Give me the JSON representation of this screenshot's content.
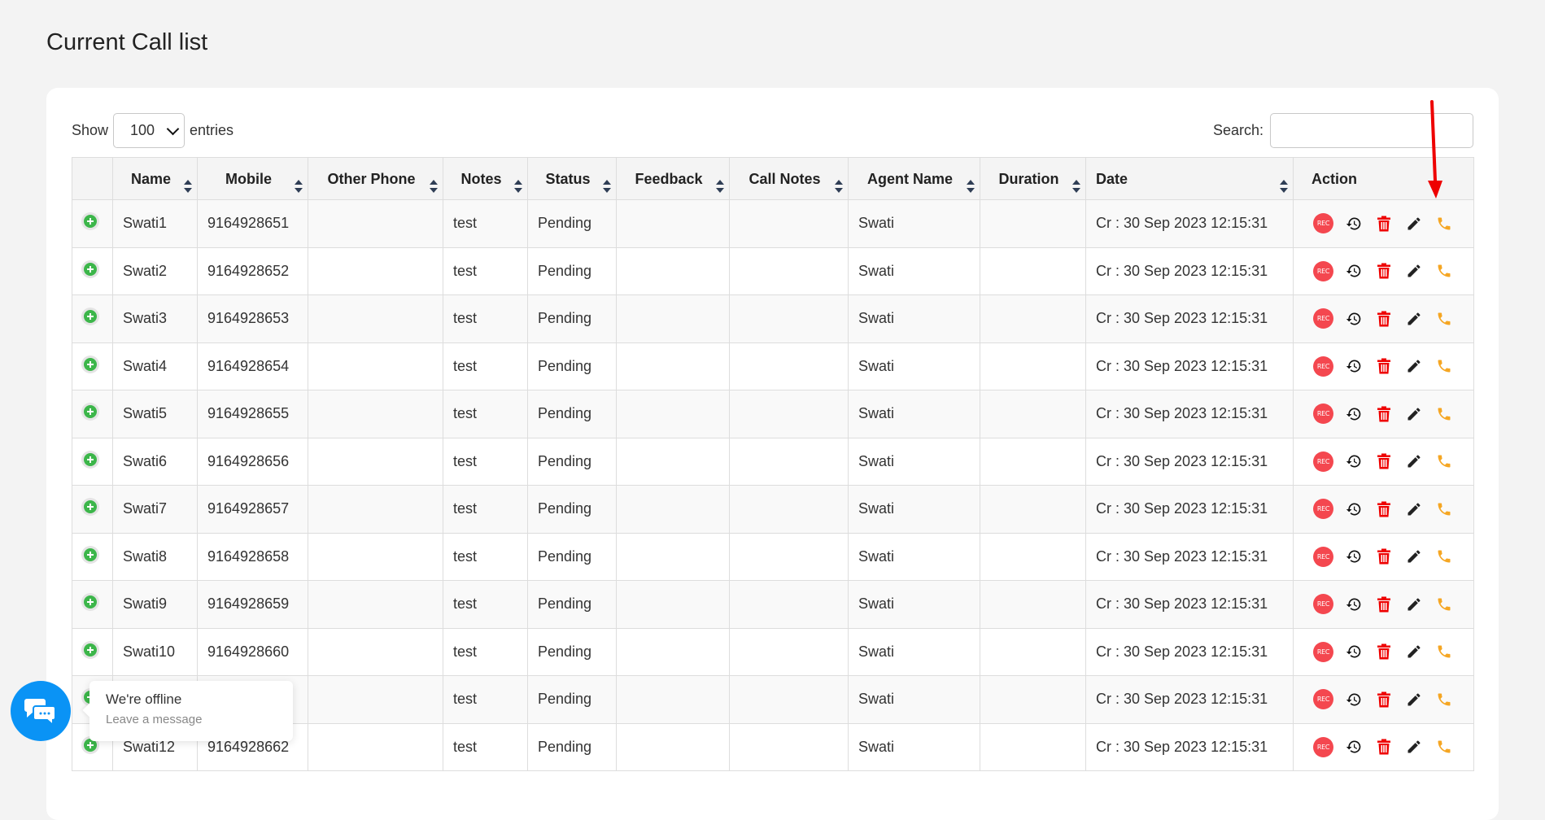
{
  "page": {
    "title": "Current Call list"
  },
  "length_control": {
    "label_before": "Show",
    "selected": "100",
    "label_after": "entries"
  },
  "search": {
    "label": "Search:",
    "value": "",
    "placeholder": ""
  },
  "table": {
    "columns": [
      {
        "key": "ctrl",
        "label": "",
        "sortable": false
      },
      {
        "key": "name",
        "label": "Name",
        "sortable": true
      },
      {
        "key": "mobile",
        "label": "Mobile",
        "sortable": true
      },
      {
        "key": "other_phone",
        "label": "Other Phone",
        "sortable": true
      },
      {
        "key": "notes",
        "label": "Notes",
        "sortable": true
      },
      {
        "key": "status",
        "label": "Status",
        "sortable": true
      },
      {
        "key": "feedback",
        "label": "Feedback",
        "sortable": true
      },
      {
        "key": "call_notes",
        "label": "Call Notes",
        "sortable": true
      },
      {
        "key": "agent_name",
        "label": "Agent Name",
        "sortable": true
      },
      {
        "key": "duration",
        "label": "Duration",
        "sortable": true
      },
      {
        "key": "date",
        "label": "Date",
        "sortable": true
      },
      {
        "key": "action",
        "label": "Action",
        "sortable": false
      }
    ],
    "rows": [
      {
        "name": "Swati1",
        "mobile": "9164928651",
        "other_phone": "",
        "notes": "test",
        "status": "Pending",
        "feedback": "",
        "call_notes": "",
        "agent_name": "Swati",
        "duration": "",
        "date": "Cr : 30 Sep 2023 12:15:31"
      },
      {
        "name": "Swati2",
        "mobile": "9164928652",
        "other_phone": "",
        "notes": "test",
        "status": "Pending",
        "feedback": "",
        "call_notes": "",
        "agent_name": "Swati",
        "duration": "",
        "date": "Cr : 30 Sep 2023 12:15:31"
      },
      {
        "name": "Swati3",
        "mobile": "9164928653",
        "other_phone": "",
        "notes": "test",
        "status": "Pending",
        "feedback": "",
        "call_notes": "",
        "agent_name": "Swati",
        "duration": "",
        "date": "Cr : 30 Sep 2023 12:15:31"
      },
      {
        "name": "Swati4",
        "mobile": "9164928654",
        "other_phone": "",
        "notes": "test",
        "status": "Pending",
        "feedback": "",
        "call_notes": "",
        "agent_name": "Swati",
        "duration": "",
        "date": "Cr : 30 Sep 2023 12:15:31"
      },
      {
        "name": "Swati5",
        "mobile": "9164928655",
        "other_phone": "",
        "notes": "test",
        "status": "Pending",
        "feedback": "",
        "call_notes": "",
        "agent_name": "Swati",
        "duration": "",
        "date": "Cr : 30 Sep 2023 12:15:31"
      },
      {
        "name": "Swati6",
        "mobile": "9164928656",
        "other_phone": "",
        "notes": "test",
        "status": "Pending",
        "feedback": "",
        "call_notes": "",
        "agent_name": "Swati",
        "duration": "",
        "date": "Cr : 30 Sep 2023 12:15:31"
      },
      {
        "name": "Swati7",
        "mobile": "9164928657",
        "other_phone": "",
        "notes": "test",
        "status": "Pending",
        "feedback": "",
        "call_notes": "",
        "agent_name": "Swati",
        "duration": "",
        "date": "Cr : 30 Sep 2023 12:15:31"
      },
      {
        "name": "Swati8",
        "mobile": "9164928658",
        "other_phone": "",
        "notes": "test",
        "status": "Pending",
        "feedback": "",
        "call_notes": "",
        "agent_name": "Swati",
        "duration": "",
        "date": "Cr : 30 Sep 2023 12:15:31"
      },
      {
        "name": "Swati9",
        "mobile": "9164928659",
        "other_phone": "",
        "notes": "test",
        "status": "Pending",
        "feedback": "",
        "call_notes": "",
        "agent_name": "Swati",
        "duration": "",
        "date": "Cr : 30 Sep 2023 12:15:31"
      },
      {
        "name": "Swati10",
        "mobile": "9164928660",
        "other_phone": "",
        "notes": "test",
        "status": "Pending",
        "feedback": "",
        "call_notes": "",
        "agent_name": "Swati",
        "duration": "",
        "date": "Cr : 30 Sep 2023 12:15:31"
      },
      {
        "name": "",
        "mobile": "",
        "other_phone": "",
        "notes": "test",
        "status": "Pending",
        "feedback": "",
        "call_notes": "",
        "agent_name": "Swati",
        "duration": "",
        "date": "Cr : 30 Sep 2023 12:15:31"
      },
      {
        "name": "Swati12",
        "mobile": "9164928662",
        "other_phone": "",
        "notes": "test",
        "status": "Pending",
        "feedback": "",
        "call_notes": "",
        "agent_name": "Swati",
        "duration": "",
        "date": "Cr : 30 Sep 2023 12:15:31"
      }
    ],
    "row_actions": [
      {
        "name": "recording",
        "icon": "rec-icon",
        "label": "REC",
        "color": "#f4474f"
      },
      {
        "name": "history",
        "icon": "history-icon",
        "color": "#111111"
      },
      {
        "name": "delete",
        "icon": "trash-icon",
        "color": "#ee0000"
      },
      {
        "name": "edit",
        "icon": "pencil-icon",
        "color": "#222222"
      },
      {
        "name": "call",
        "icon": "phone-icon",
        "color": "#f5a623"
      }
    ]
  },
  "annotation": {
    "type": "arrow",
    "color": "#ee0000",
    "points_to": "call-button (row 1)"
  },
  "chat_widget": {
    "status_title": "We're offline",
    "subtitle": "Leave a message",
    "color": "#0a93f5"
  }
}
